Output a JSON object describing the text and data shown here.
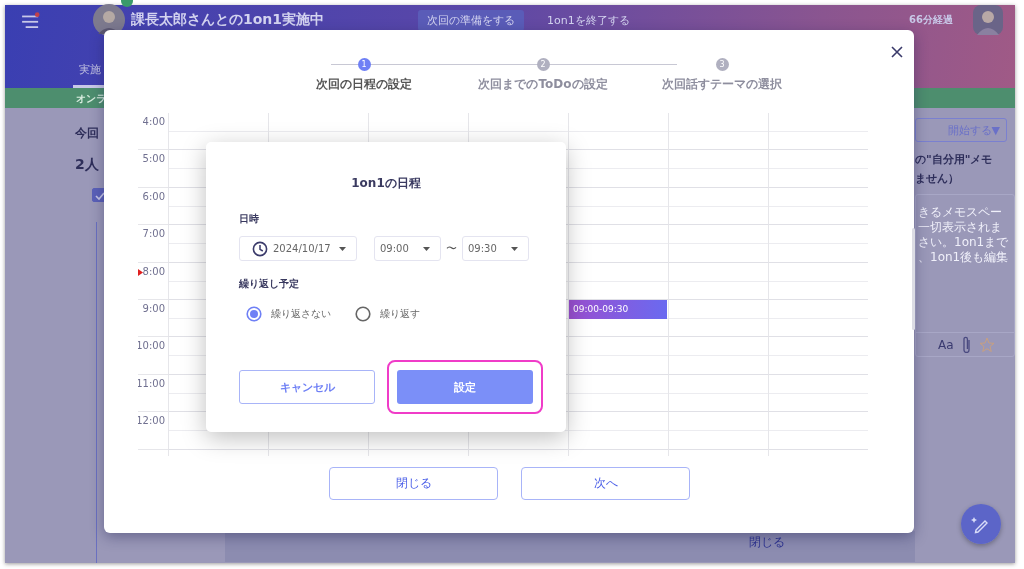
{
  "header": {
    "title": "課長太郎さんとの1on1実施中",
    "buttons": [
      {
        "label": "次回の準備をする",
        "kind": "filled"
      },
      {
        "label": "1on1を終了する",
        "kind": "plain"
      }
    ],
    "elapsed": "66分経過"
  },
  "tabs": [
    {
      "label": "実施",
      "selected": true
    }
  ],
  "banner": "オンラ",
  "left_panel": {
    "heading": "今回",
    "subheading": "2人",
    "checked": true
  },
  "right_panel": {
    "start_button": "開始する▼",
    "memo_title": "の\"自分用\"メモ",
    "memo_title_2": "ません）",
    "memo_lines": [
      "きるメモスペー",
      "一切表示されま",
      "さい。1on1まで",
      "、1on1後も編集"
    ],
    "font_label": "Aa",
    "starred": false
  },
  "bottom_button": "閉じる",
  "wizard": {
    "steps": [
      {
        "number": "1",
        "label": "次回の日程の設定",
        "selected": true
      },
      {
        "number": "2",
        "label": "次回までのToDoの設定",
        "selected": false
      },
      {
        "number": "3",
        "label": "次回話すテーマの選択",
        "selected": false
      }
    ],
    "calendar": {
      "rows": [
        {
          "time": "4:00",
          "now": false
        },
        {
          "time": "5:00",
          "now": false
        },
        {
          "time": "6:00",
          "now": false
        },
        {
          "time": "7:00",
          "now": false
        },
        {
          "time": "8:00",
          "now": true
        },
        {
          "time": "9:00",
          "now": false,
          "event": "09:00-09:30"
        },
        {
          "time": "10:00",
          "now": false
        },
        {
          "time": "11:00",
          "now": false
        },
        {
          "time": "12:00",
          "now": false
        }
      ]
    },
    "buttons": [
      "閉じる",
      "次へ"
    ]
  },
  "dialog": {
    "title": "1on1の日程",
    "date_label": "日時",
    "date": "2024/10/17",
    "start_time": "09:00",
    "separator": "〜",
    "end_time": "09:30",
    "repeat_label": "繰り返し予定",
    "repeat_options": [
      {
        "label": "繰り返さない",
        "selected": true
      },
      {
        "label": "繰り返す",
        "selected": false
      }
    ],
    "buttons": [
      {
        "label": "キャンセル",
        "kind": "outline",
        "highlighted": false
      },
      {
        "label": "設定",
        "kind": "primary",
        "highlighted": true
      }
    ]
  }
}
